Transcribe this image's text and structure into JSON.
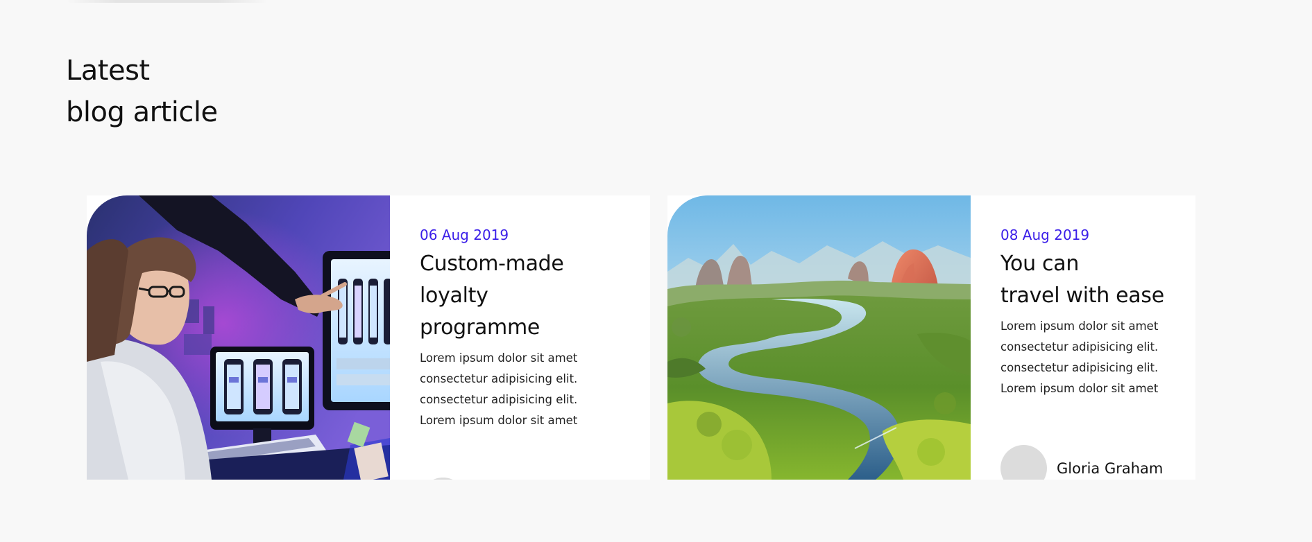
{
  "section": {
    "title_line1": "Latest",
    "title_line2": "blog article"
  },
  "articles": [
    {
      "date": "06 Aug 2019",
      "title_lines": [
        "Custom-made",
        "loyalty",
        "programme"
      ],
      "excerpt_lines": [
        "Lorem ipsum dolor sit amet",
        "consectetur adipisicing elit.",
        "consectetur adipisicing elit.",
        "Lorem ipsum dolor sit amet"
      ],
      "author": ""
    },
    {
      "date": "08 Aug 2019",
      "title_lines": [
        "You can",
        "travel with ease"
      ],
      "excerpt_lines": [
        "Lorem ipsum dolor sit amet",
        "consectetur adipisicing elit.",
        "consectetur adipisicing elit.",
        "Lorem ipsum dolor sit amet"
      ],
      "author": "Gloria Graham"
    }
  ],
  "colors": {
    "page_background": "#f8f8f8",
    "card_background": "#ffffff",
    "date_accent": "#3a1ee8",
    "heading": "#111111",
    "body_text": "#222222",
    "avatar_placeholder": "#dcdcdc"
  }
}
